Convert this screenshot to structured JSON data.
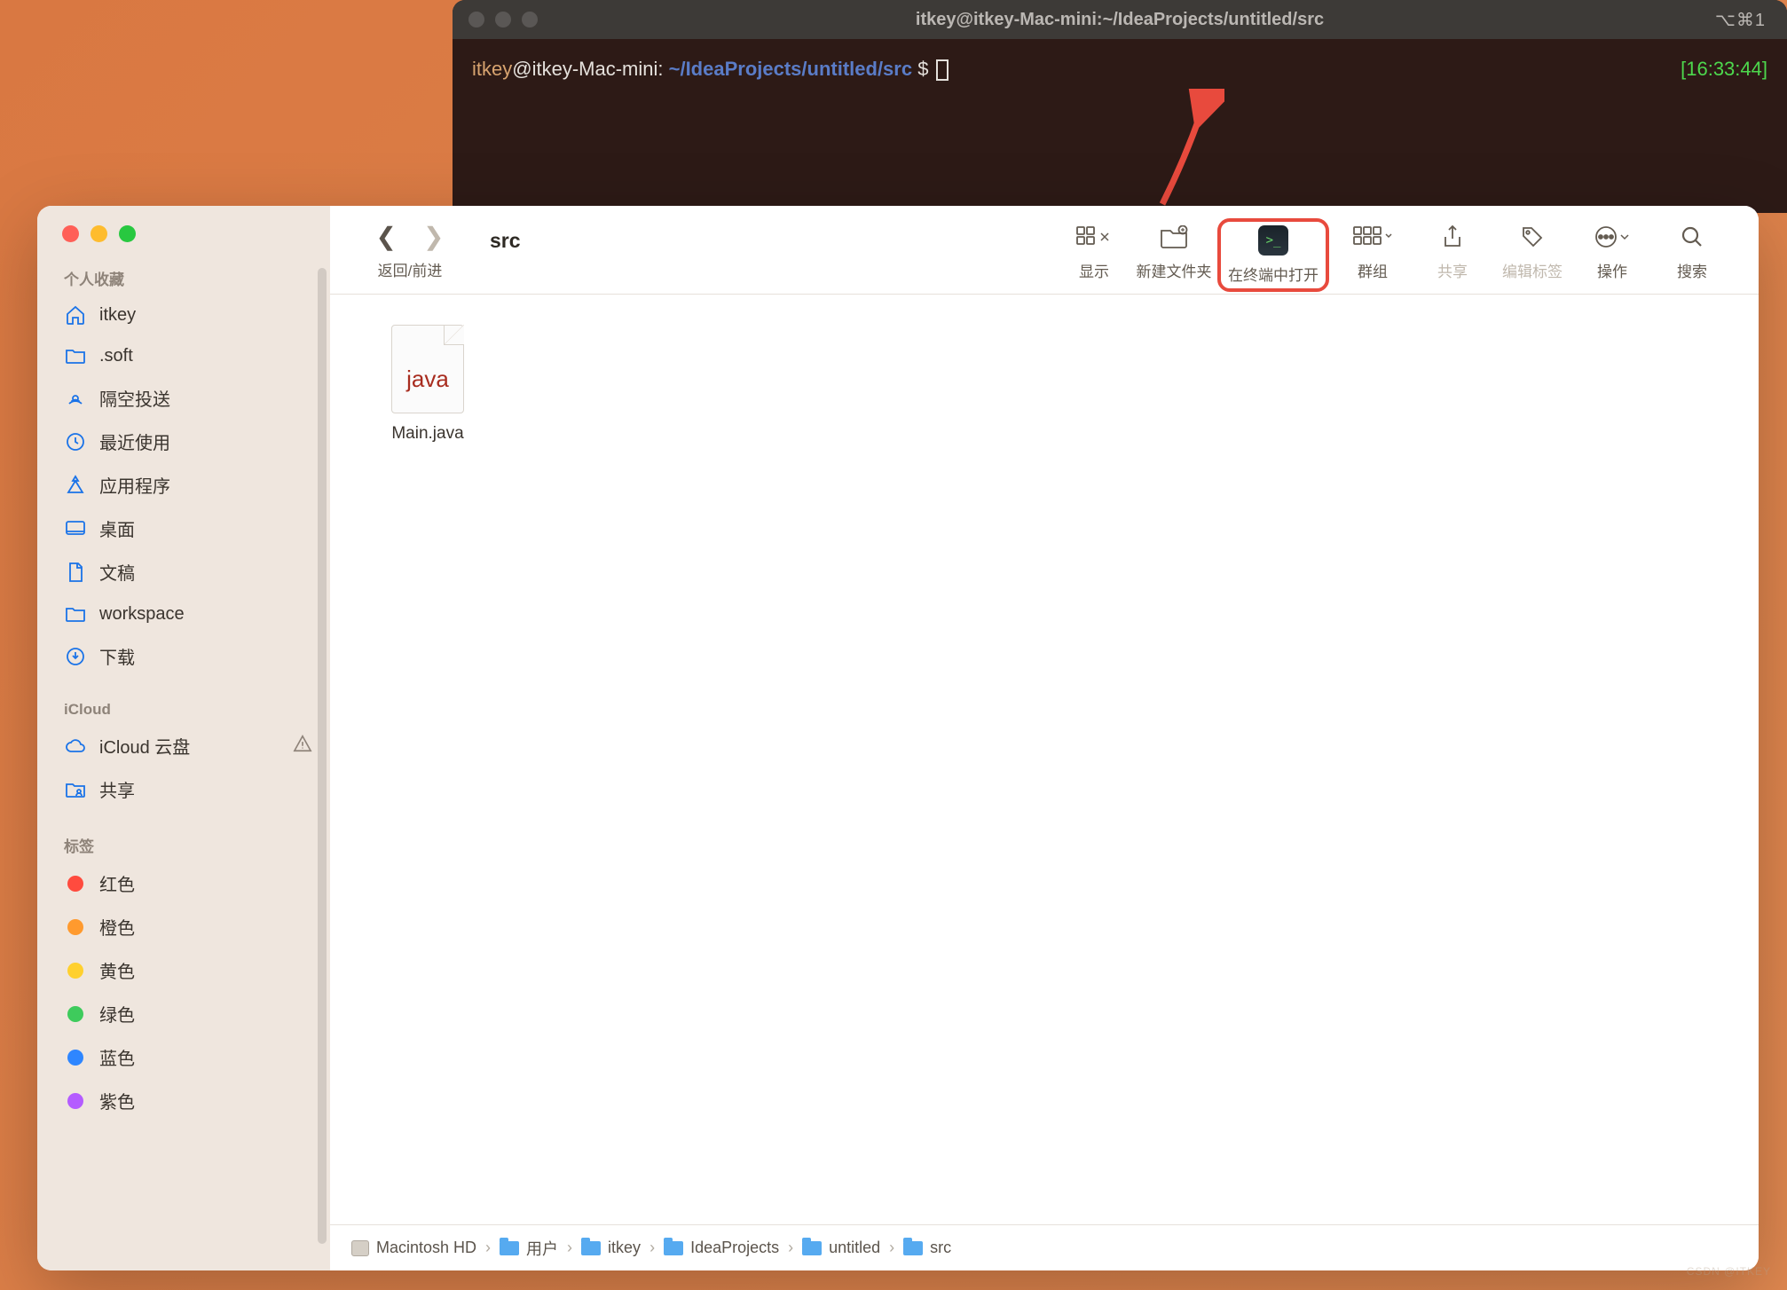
{
  "terminal": {
    "title": "itkey@itkey-Mac-mini:~/IdeaProjects/untitled/src",
    "shortcut": "⌥⌘1",
    "prompt_user": "itkey",
    "prompt_host": "@itkey-Mac-mini",
    "prompt_colon": ": ",
    "prompt_path": "~/IdeaProjects/untitled/src",
    "prompt_dollar": " $ ",
    "time": "[16:33:44]"
  },
  "finder": {
    "title": "src",
    "nav_label": "返回/前进",
    "toolbar": {
      "view": "显示",
      "new_folder": "新建文件夹",
      "open_terminal": "在终端中打开",
      "groups": "群组",
      "share": "共享",
      "tags": "编辑标签",
      "actions": "操作",
      "search": "搜索"
    },
    "sidebar": {
      "favorites_title": "个人收藏",
      "favorites": [
        {
          "label": "itkey",
          "icon": "home"
        },
        {
          "label": ".soft",
          "icon": "folder"
        },
        {
          "label": "隔空投送",
          "icon": "airdrop"
        },
        {
          "label": "最近使用",
          "icon": "clock"
        },
        {
          "label": "应用程序",
          "icon": "apps"
        },
        {
          "label": "桌面",
          "icon": "desktop"
        },
        {
          "label": "文稿",
          "icon": "doc"
        },
        {
          "label": "workspace",
          "icon": "folder"
        },
        {
          "label": "下载",
          "icon": "download"
        }
      ],
      "icloud_title": "iCloud",
      "icloud": [
        {
          "label": "iCloud 云盘",
          "icon": "cloud",
          "warn": true
        },
        {
          "label": "共享",
          "icon": "shared"
        }
      ],
      "tags_title": "标签",
      "tags": [
        {
          "label": "红色",
          "color": "#ff4b3e"
        },
        {
          "label": "橙色",
          "color": "#ff9a2e"
        },
        {
          "label": "黄色",
          "color": "#ffd02e"
        },
        {
          "label": "绿色",
          "color": "#3ecb5c"
        },
        {
          "label": "蓝色",
          "color": "#2e86ff"
        },
        {
          "label": "紫色",
          "color": "#b45cff"
        }
      ]
    },
    "files": [
      {
        "name": "Main.java",
        "type": "java"
      }
    ],
    "path": [
      {
        "label": "Macintosh HD",
        "icon": "disk"
      },
      {
        "label": "用户",
        "icon": "folder"
      },
      {
        "label": "itkey",
        "icon": "folder"
      },
      {
        "label": "IdeaProjects",
        "icon": "folder"
      },
      {
        "label": "untitled",
        "icon": "folder"
      },
      {
        "label": "src",
        "icon": "folder"
      }
    ]
  },
  "watermark": "CSDN @ITKEY"
}
